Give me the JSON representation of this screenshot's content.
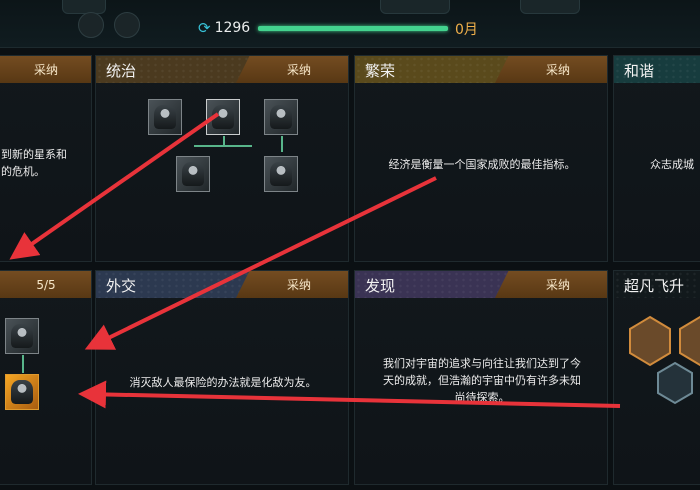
{
  "top_bar": {
    "unity_icon": "unity-cycle-icon",
    "unity_value": "1296",
    "progress_fraction": 1.0,
    "month_text": "0月"
  },
  "colors": {
    "accent_green": "#43d28e",
    "arrow_red": "#e8333a",
    "adopt_button": "#6b4419",
    "month_gold": "#f0b04a"
  },
  "traditions": [
    {
      "key": "left_top",
      "title": "",
      "button": "采纳",
      "desc": "到新的星系和\n的危机。"
    },
    {
      "key": "dominion",
      "title": "统治",
      "button": "采纳",
      "desc": ""
    },
    {
      "key": "prosperity",
      "title": "繁荣",
      "button": "采纳",
      "desc": "经济是衡量一个国家成败的最佳指标。"
    },
    {
      "key": "harmony",
      "title": "和谐",
      "button": "",
      "desc": "众志成城"
    },
    {
      "key": "left_bottom",
      "title": "",
      "button": "5/5",
      "desc": ""
    },
    {
      "key": "diplomacy",
      "title": "外交",
      "button": "采纳",
      "desc": "消灭敌人最保险的办法就是化敌为友。"
    },
    {
      "key": "discovery",
      "title": "发现",
      "button": "采纳",
      "desc": "我们对宇宙的追求与向往让我们达到了今\n天的成就，但浩瀚的宇宙中仍有许多未知\n尚待探索。"
    },
    {
      "key": "transcendence",
      "title": "超凡飞升",
      "button": "",
      "desc": ""
    }
  ]
}
